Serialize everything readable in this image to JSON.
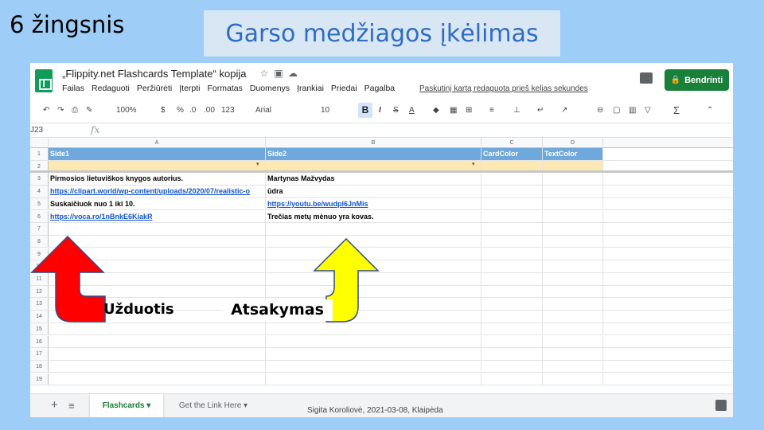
{
  "slide": {
    "step_title": "6 žingsnis",
    "main_title": "Garso medžiagos įkėlimas",
    "footer": "Sigita Koroliovė, 2021-03-08, Klaipėda",
    "label_task": "Užduotis",
    "label_answer": "Atsakymas",
    "colors": {
      "background": "#9ecdf7",
      "title_color": "#2f6cc4",
      "task_arrow": "#ff0000",
      "answer_arrow": "#ffff00"
    }
  },
  "app": {
    "doc_title": "„Flippity.net Flashcards Template“ kopija",
    "menu": [
      "Failas",
      "Redaguoti",
      "Peržiūrėti",
      "Įterpti",
      "Formatas",
      "Duomenys",
      "Įrankiai",
      "Priedai",
      "Pagalba"
    ],
    "last_edit": "Paskutinį kartą redaguota prieš kelias sekundes",
    "share_label": "Bendrinti",
    "toolbar": {
      "zoom": "100%",
      "currency": "$",
      "percent": "%",
      "dec0": ".0",
      "dec00": ".00",
      "format123": "123",
      "font": "Arial",
      "size": "10",
      "bold": "B",
      "italic": "I",
      "strike": "S",
      "text_a": "A"
    },
    "name_box": "J23",
    "fx": "fx"
  },
  "grid": {
    "columns": [
      "A",
      "B",
      "C",
      "D"
    ],
    "rows": [
      {
        "n": "1",
        "cells": [
          "Side1",
          "Side2",
          "CardColor",
          "TextColor"
        ]
      },
      {
        "n": "2",
        "cells": [
          "",
          "",
          "",
          ""
        ]
      },
      {
        "n": "3",
        "cells": [
          "Pirmosios lietuviškos knygos autorius.",
          "Martynas Mažvydas",
          "",
          ""
        ]
      },
      {
        "n": "4",
        "cells": [
          "https://clipart.world/wp-content/uploads/2020/07/realistic-o",
          "ūdra",
          "",
          ""
        ]
      },
      {
        "n": "5",
        "cells": [
          "Suskaičiuok nuo 1 iki 10.",
          "https://youtu.be/wudpl6JnMis",
          "",
          ""
        ]
      },
      {
        "n": "6",
        "cells": [
          "https://voca.ro/1nBnkE6KiakR",
          "Trečias metų mėnuo yra kovas.",
          "",
          ""
        ]
      },
      {
        "n": "7",
        "cells": [
          "",
          "",
          "",
          ""
        ]
      },
      {
        "n": "8",
        "cells": [
          "",
          "",
          "",
          ""
        ]
      },
      {
        "n": "9",
        "cells": [
          "",
          "",
          "",
          ""
        ]
      },
      {
        "n": "10",
        "cells": [
          "",
          "",
          "",
          ""
        ]
      },
      {
        "n": "11",
        "cells": [
          "",
          "",
          "",
          ""
        ]
      },
      {
        "n": "12",
        "cells": [
          "",
          "",
          "",
          ""
        ]
      },
      {
        "n": "13",
        "cells": [
          "",
          "",
          "",
          ""
        ]
      },
      {
        "n": "14",
        "cells": [
          "",
          "",
          "",
          ""
        ]
      },
      {
        "n": "15",
        "cells": [
          "",
          "",
          "",
          ""
        ]
      },
      {
        "n": "16",
        "cells": [
          "",
          "",
          "",
          ""
        ]
      },
      {
        "n": "17",
        "cells": [
          "",
          "",
          "",
          ""
        ]
      },
      {
        "n": "18",
        "cells": [
          "",
          "",
          "",
          ""
        ]
      },
      {
        "n": "19",
        "cells": [
          "",
          "",
          "",
          ""
        ]
      }
    ]
  },
  "sheets": {
    "active": "Flashcards",
    "other": "Get the Link Here"
  }
}
